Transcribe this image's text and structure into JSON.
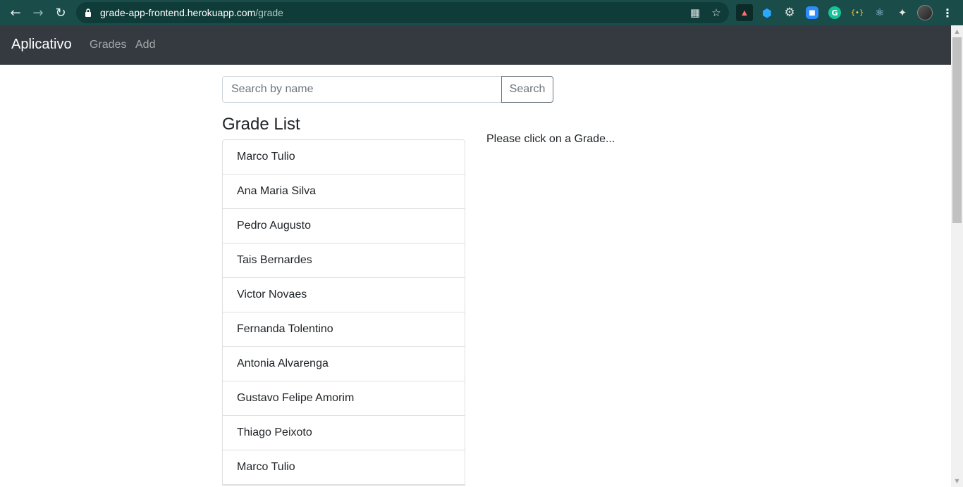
{
  "browser": {
    "url_host": "grade-app-frontend.herokuapp.com",
    "url_path": "/grade",
    "icons": [
      "back-arrow-icon",
      "forward-arrow-icon",
      "reload-icon",
      "lock-icon",
      "translate-icon",
      "star-icon"
    ],
    "extensions": [
      "pdf-extension-icon",
      "hex-extension-icon",
      "gear-extension-icon",
      "zoom-extension-icon",
      "grammarly-extension-icon",
      "braces-extension-icon",
      "react-devtools-icon",
      "puzzle-extensions-icon",
      "profile-avatar",
      "kebab-menu-icon"
    ],
    "toolbar_color": "#1a4d4a"
  },
  "navbar": {
    "brand": "Aplicativo",
    "links": [
      "Grades",
      "Add"
    ],
    "background": "#343a40"
  },
  "search": {
    "placeholder": "Search by name",
    "value": "",
    "button_label": "Search"
  },
  "grade_list": {
    "title": "Grade List",
    "items": [
      "Marco Tulio",
      "Ana Maria Silva",
      "Pedro Augusto",
      "Tais Bernardes",
      "Victor Novaes",
      "Fernanda Tolentino",
      "Antonia Alvarenga",
      "Gustavo Felipe Amorim",
      "Thiago Peixoto",
      "Marco Tulio"
    ]
  },
  "detail": {
    "hint": "Please click on a Grade..."
  }
}
